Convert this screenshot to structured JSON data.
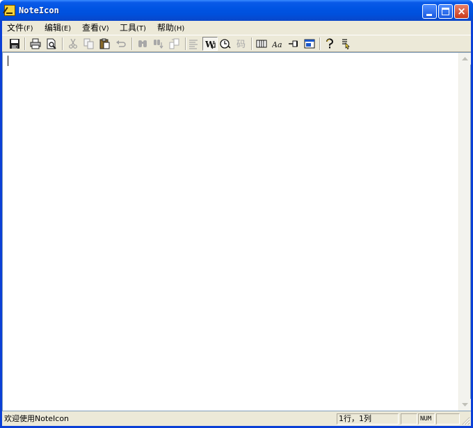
{
  "window": {
    "title": "NoteIcon"
  },
  "menu": {
    "items": [
      {
        "label": "文件",
        "accel": "(F)"
      },
      {
        "label": "编辑",
        "accel": "(E)"
      },
      {
        "label": "查看",
        "accel": "(V)"
      },
      {
        "label": "工具",
        "accel": "(T)"
      },
      {
        "label": "帮助",
        "accel": "(H)"
      }
    ]
  },
  "toolbar": {
    "code_label": "码",
    "font_label": "Aa"
  },
  "statusbar": {
    "message": "欢迎使用NoteIcon",
    "position": "1行，1列",
    "caps": "",
    "num": "NUM",
    "scroll": ""
  }
}
